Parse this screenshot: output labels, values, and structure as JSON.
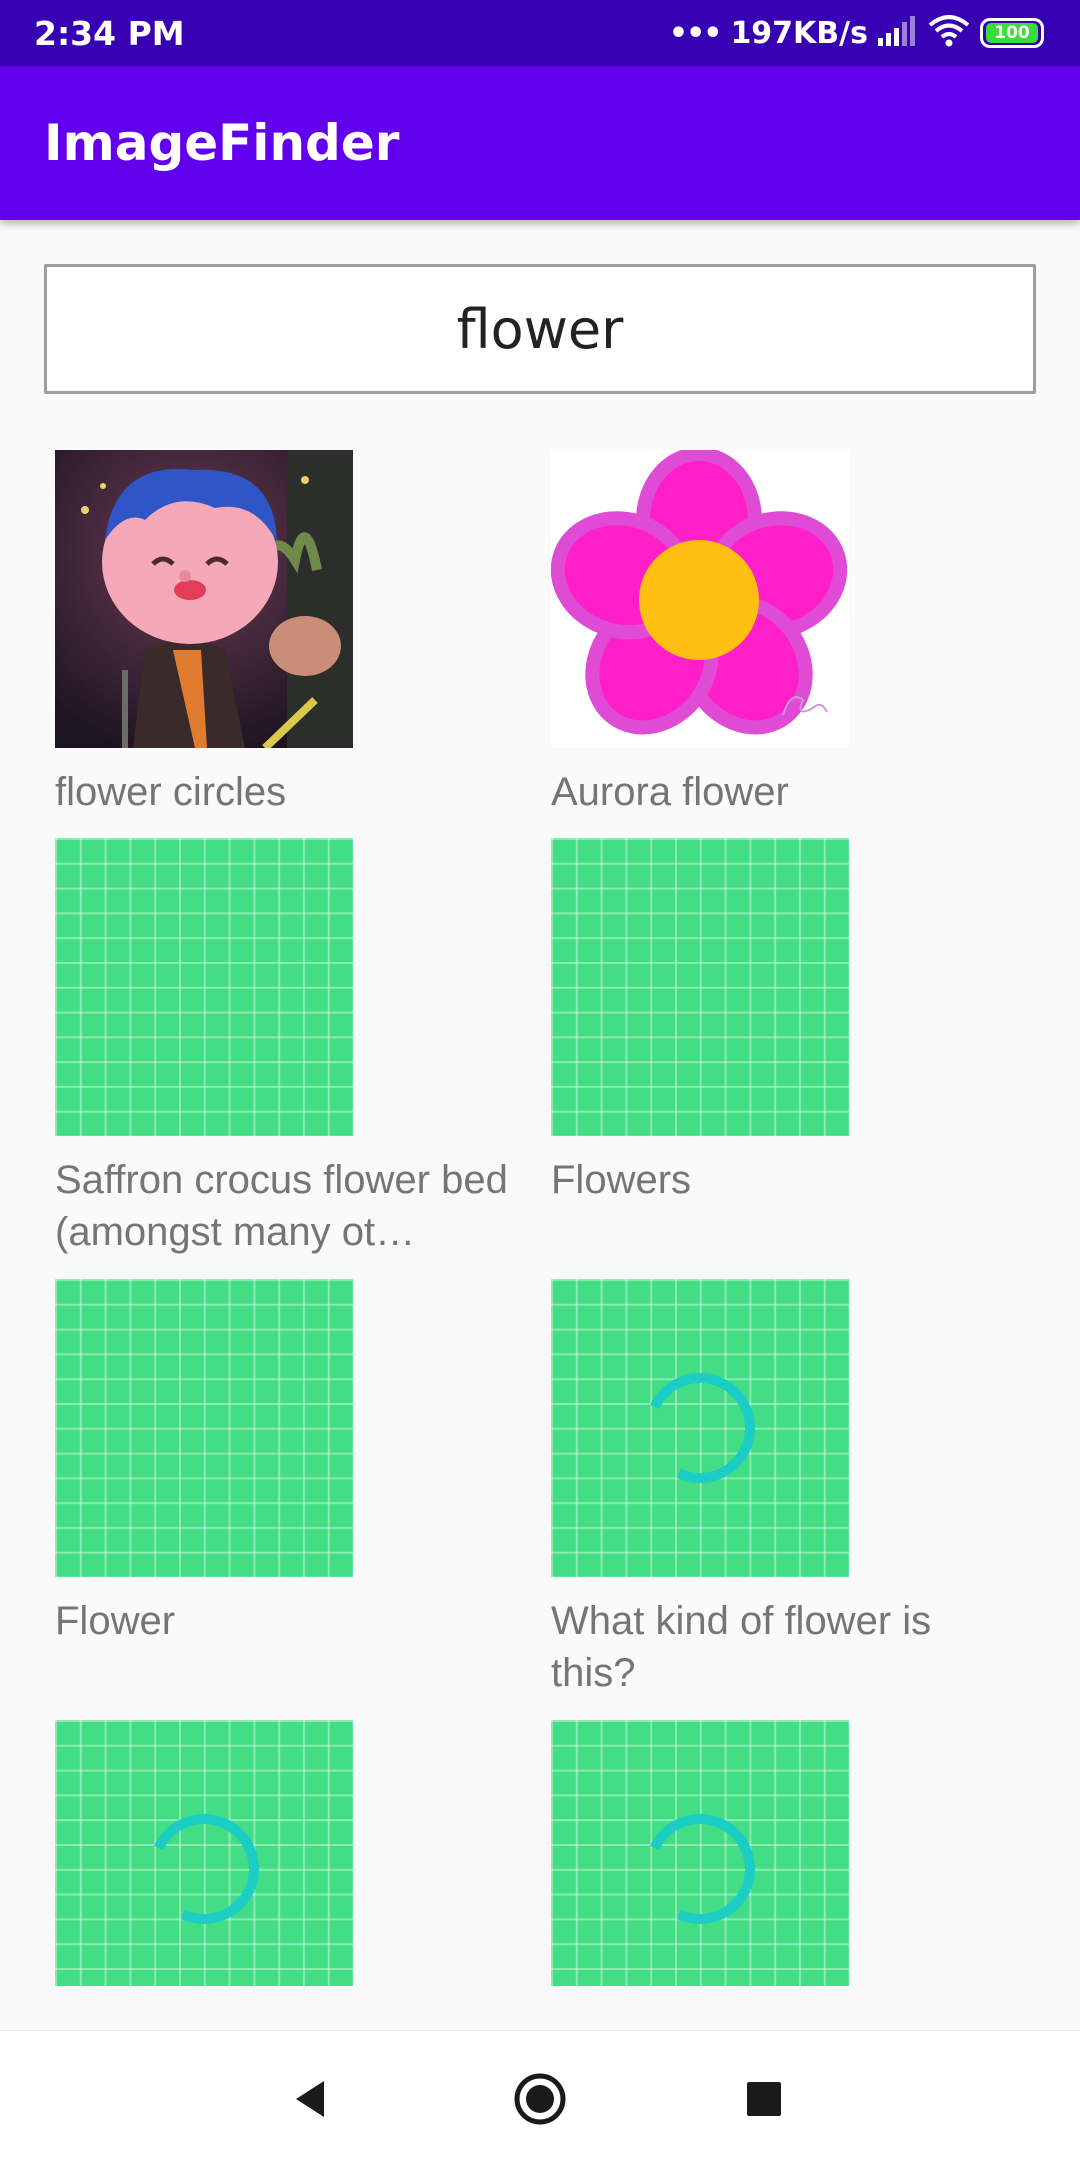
{
  "status_bar": {
    "time": "2:34 PM",
    "network_speed": "197KB/s",
    "battery": "100",
    "icons": [
      "dots-icon",
      "signal-icon",
      "wifi-icon",
      "battery-icon"
    ]
  },
  "app_bar": {
    "title": "ImageFinder"
  },
  "search": {
    "value": "flower"
  },
  "results": [
    {
      "caption": "flower circles",
      "image": "avatar-character-photo",
      "loading": false
    },
    {
      "caption": "Aurora flower",
      "image": "pink-flower-drawing",
      "loading": false
    },
    {
      "caption": "Saffron crocus flower bed (amongst many ot…",
      "image": "placeholder-grid",
      "loading": false
    },
    {
      "caption": "Flowers",
      "image": "placeholder-grid",
      "loading": false
    },
    {
      "caption": "Flower",
      "image": "placeholder-grid",
      "loading": false
    },
    {
      "caption": "What kind of flower is this?",
      "image": "placeholder-grid",
      "loading": true
    },
    {
      "caption": "",
      "image": "placeholder-grid",
      "loading": true
    },
    {
      "caption": "",
      "image": "placeholder-grid",
      "loading": true
    }
  ],
  "colors": {
    "status_bar": "#3700b3",
    "app_bar": "#6200ee",
    "placeholder": "#42dd84",
    "spinner": "#1bcdc4",
    "caption": "#757575"
  },
  "nav_bar": {
    "icons": [
      "back-icon",
      "home-icon",
      "recents-icon"
    ]
  }
}
